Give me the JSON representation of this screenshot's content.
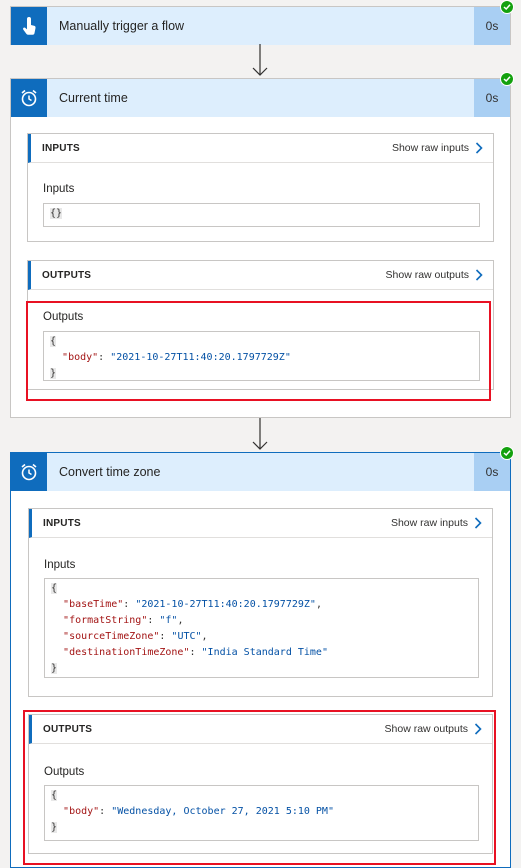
{
  "steps": [
    {
      "title": "Manually trigger a flow",
      "duration": "0s",
      "icon": "touch-icon"
    },
    {
      "title": "Current time",
      "duration": "0s",
      "icon": "alarm-clock-icon",
      "inputs": {
        "header": "INPUTS",
        "raw_label": "Show raw inputs",
        "field_label": "Inputs",
        "value": "{}"
      },
      "outputs": {
        "header": "OUTPUTS",
        "raw_label": "Show raw outputs",
        "field_label": "Outputs",
        "open_brace": "{",
        "close_brace": "}",
        "lines": [
          {
            "key": "\"body\"",
            "value": "\"2021-10-27T11:40:20.1797729Z\"",
            "trail": ""
          }
        ]
      }
    },
    {
      "title": "Convert time zone",
      "duration": "0s",
      "icon": "alarm-clock-icon",
      "inputs": {
        "header": "INPUTS",
        "raw_label": "Show raw inputs",
        "field_label": "Inputs",
        "open_brace": "{",
        "close_brace": "}",
        "lines": [
          {
            "key": "\"baseTime\"",
            "value": "\"2021-10-27T11:40:20.1797729Z\"",
            "trail": ","
          },
          {
            "key": "\"formatString\"",
            "value": "\"f\"",
            "trail": ","
          },
          {
            "key": "\"sourceTimeZone\"",
            "value": "\"UTC\"",
            "trail": ","
          },
          {
            "key": "\"destinationTimeZone\"",
            "value": "\"India Standard Time\"",
            "trail": ""
          }
        ]
      },
      "outputs": {
        "header": "OUTPUTS",
        "raw_label": "Show raw outputs",
        "field_label": "Outputs",
        "open_brace": "{",
        "close_brace": "}",
        "lines": [
          {
            "key": "\"body\"",
            "value": "\"Wednesday, October 27, 2021 5:10 PM\"",
            "trail": ""
          }
        ]
      }
    }
  ],
  "colors": {
    "accent": "#0f6cbd",
    "header_bg": "#ddeefd",
    "success": "#13a10e",
    "highlight": "#e81123"
  }
}
